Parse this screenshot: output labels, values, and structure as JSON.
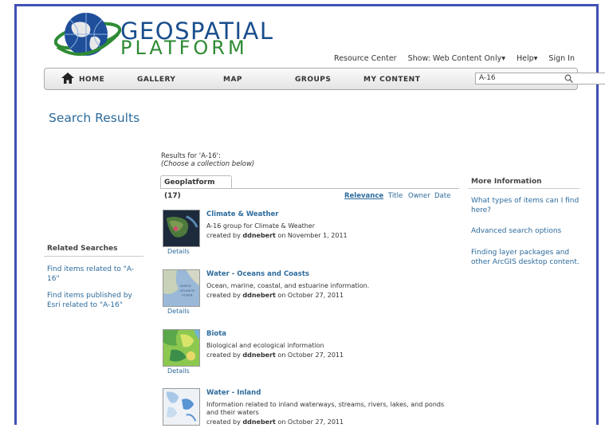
{
  "brand": {
    "line1": "GEOSPATIAL",
    "line2": "PLATFORM"
  },
  "toplinks": {
    "resource_center": "Resource Center",
    "show": "Show: Web Content Only▾",
    "help": "Help▾",
    "sign_in": "Sign In"
  },
  "nav": {
    "home": "HOME",
    "gallery": "GALLERY",
    "map": "MAP",
    "groups": "GROUPS",
    "my_content": "MY CONTENT",
    "search_value": "A-16"
  },
  "page_title": "Search Results",
  "results": {
    "results_for": "Results for 'A-16':",
    "choose": "(Choose a collection below)",
    "tab": "Geoplatform (17)",
    "sort": {
      "relevance": "Relevance",
      "title": "Title",
      "owner": "Owner",
      "date": "Date"
    },
    "items": [
      {
        "title": "Climate & Weather",
        "desc": "A-16 group for Climate & Weather",
        "created": "created by",
        "owner": "ddnebert",
        "date": "on November 1, 2011",
        "details": "Details"
      },
      {
        "title": "Water - Oceans and Coasts",
        "desc": "Ocean, marine, coastal, and estuarine information.",
        "created": "created by",
        "owner": "ddnebert",
        "date": "on October 27, 2011",
        "details": "Details"
      },
      {
        "title": "Biota",
        "desc": "Biological and ecological information",
        "created": "created by",
        "owner": "ddnebert",
        "date": "on October 27, 2011",
        "details": "Details"
      },
      {
        "title": "Water - Inland",
        "desc": "Information related to inland waterways, streams, rivers, lakes, and ponds and their waters",
        "created": "created by",
        "owner": "ddnebert",
        "date": "on October 27, 2011"
      }
    ]
  },
  "related": {
    "heading": "Related Searches",
    "link1": "Find items related to \"A-16\"",
    "link2": "Find items published by Esri related to \"A-16\""
  },
  "more_info": {
    "heading": "More Information",
    "link1": "What types of items can I find here?",
    "link2": "Advanced search options",
    "link3": "Finding layer packages and other ArcGIS desktop content."
  }
}
